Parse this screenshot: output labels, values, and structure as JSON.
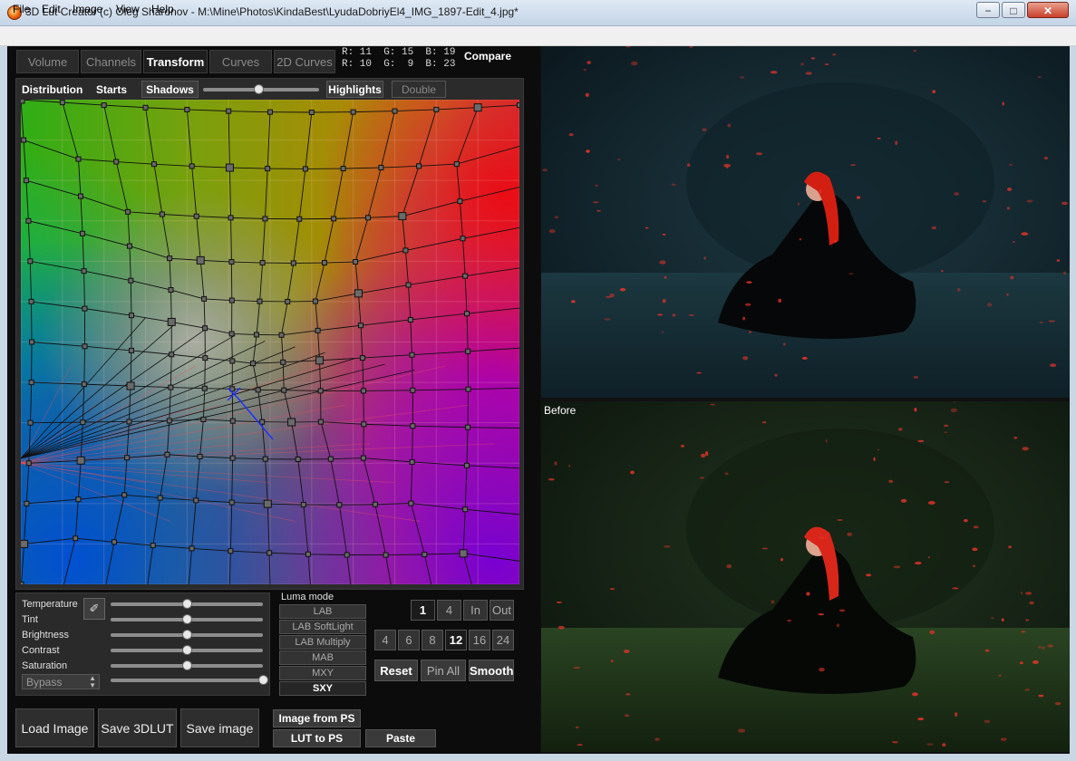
{
  "window": {
    "title": "3D Lut Creator (c) Oleg Sharonov - M:\\Mine\\Photos\\KindaBest\\LyudaDobriyEl4_IMG_1897-Edit_4.jpg*",
    "minimize": "−",
    "maximize": "□",
    "close": "✕"
  },
  "menu": {
    "file": "File",
    "edit": "Edit",
    "image": "Image",
    "view": "View",
    "help": "Help"
  },
  "tabs": [
    {
      "label": "Volume",
      "active": false
    },
    {
      "label": "Channels",
      "active": false
    },
    {
      "label": "Transform",
      "active": true
    },
    {
      "label": "Curves",
      "active": false
    },
    {
      "label": "2D Curves",
      "active": false
    }
  ],
  "rgb_readout": {
    "line1": "R: 11  G: 15  B: 19",
    "line2": "R: 10  G:  9  B: 23"
  },
  "compare_label": "Compare",
  "transform": {
    "distribution": "Distribution",
    "starts": "Starts",
    "shadows": "Shadows",
    "highlights": "Highlights",
    "double": "Double",
    "balance_slider": 0.48
  },
  "adjustments": {
    "items": [
      {
        "label": "Temperature",
        "value": 0.5
      },
      {
        "label": "Tint",
        "value": 0.5
      },
      {
        "label": "Brightness",
        "value": 0.5
      },
      {
        "label": "Contrast",
        "value": 0.5
      },
      {
        "label": "Saturation",
        "value": 0.5
      }
    ],
    "mode_select": "Bypass",
    "mix_slider": 1.0,
    "eyedropper_icon": "eyedropper-icon"
  },
  "luma": {
    "label": "Luma mode",
    "modes": [
      "LAB",
      "LAB SoftLight",
      "LAB Multiply",
      "MAB",
      "MXY",
      "SXY"
    ],
    "selected": "SXY"
  },
  "grid_view": {
    "view_buttons": [
      "1",
      "4",
      "In",
      "Out"
    ],
    "view_selected": "1",
    "size_buttons": [
      "4",
      "6",
      "8",
      "12",
      "16",
      "24"
    ],
    "size_selected": "12"
  },
  "actions": {
    "reset": "Reset",
    "pin_all": "Pin All",
    "smooth": "Smooth"
  },
  "bottom_buttons": {
    "load_image": "Load Image",
    "save_3dlut": "Save 3DLUT",
    "save_image": "Save image",
    "image_from_ps": "Image from PS",
    "lut_to_ps": "LUT to PS",
    "paste": "Paste"
  },
  "preview": {
    "before_label": "Before"
  },
  "colors": {
    "accent_red": "#e8352a",
    "panel": "#2b2b2b",
    "dark": "#0c0c0c"
  }
}
